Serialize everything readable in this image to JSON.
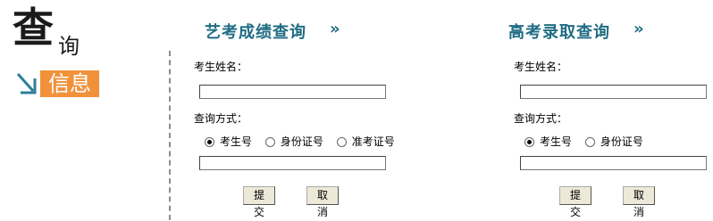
{
  "logo": {
    "main_char": "查",
    "sub_char": "询",
    "boxed_text": "信息"
  },
  "art_exam": {
    "title": "艺考成绩查询",
    "chevron": "»",
    "name_label": "考生姓名：",
    "name_value": "",
    "method_label": "查询方式：",
    "options": [
      "考生号",
      "身份证号",
      "准考证号"
    ],
    "selected_option": "考生号",
    "id_value": "",
    "submit_label": "提交",
    "cancel_label": "取消"
  },
  "admission": {
    "title": "高考录取查询",
    "chevron": "»",
    "name_label": "考生姓名：",
    "name_value": "",
    "method_label": "查询方式：",
    "options": [
      "考生号",
      "身份证号"
    ],
    "selected_option": "考生号",
    "id_value": "",
    "submit_label": "提交",
    "cancel_label": "取消"
  },
  "colors": {
    "title": "#1f6c83",
    "logo_orange": "#f1923a",
    "logo_arrow": "#2d7f96"
  }
}
